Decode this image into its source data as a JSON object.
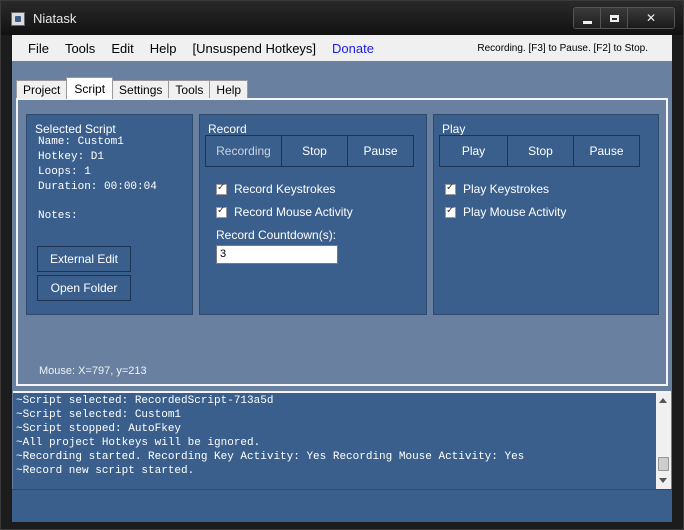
{
  "window": {
    "title": "Niatask",
    "controls": {
      "minimize": "minimize-icon",
      "maximize": "maximize-icon",
      "close": "✕"
    }
  },
  "menu": {
    "items": [
      "File",
      "Tools",
      "Edit",
      "Help",
      "[Unsuspend Hotkeys]"
    ],
    "donate": "Donate",
    "status": "Recording. [F3] to Pause. [F2] to Stop."
  },
  "tabs": [
    "Project",
    "Script",
    "Settings",
    "Tools",
    "Help"
  ],
  "active_tab": "Script",
  "selected_script": {
    "title": "Selected Script",
    "name": "Name: Custom1",
    "hotkey": "Hotkey: D1",
    "loops": "Loops: 1",
    "duration": "Duration: 00:00:04",
    "notes": "Notes:",
    "external_edit": "External Edit",
    "open_folder": "Open Folder"
  },
  "record": {
    "title": "Record",
    "buttons": [
      "Recording",
      "Stop",
      "Pause"
    ],
    "record_keystrokes": "Record Keystrokes",
    "record_mouse": "Record Mouse Activity",
    "countdown_label": "Record Countdown(s):",
    "countdown_value": "3"
  },
  "play": {
    "title": "Play",
    "buttons": [
      "Play",
      "Stop",
      "Pause"
    ],
    "play_keystrokes": "Play Keystrokes",
    "play_mouse": "Play Mouse Activity"
  },
  "mouse_readout": "Mouse: X=797, y=213",
  "log": [
    "~Script selected: RecordedScript-713a5d",
    "~Script selected: Custom1",
    "~Script stopped: AutoFkey",
    "~All project Hotkeys will be ignored.",
    "~Recording started. Recording Key Activity: Yes Recording Mouse Activity: Yes",
    "~Record new script started."
  ],
  "colors": {
    "panel": "#3a5f8c",
    "client": "#6a80a0",
    "donate": "#1a1aee"
  }
}
